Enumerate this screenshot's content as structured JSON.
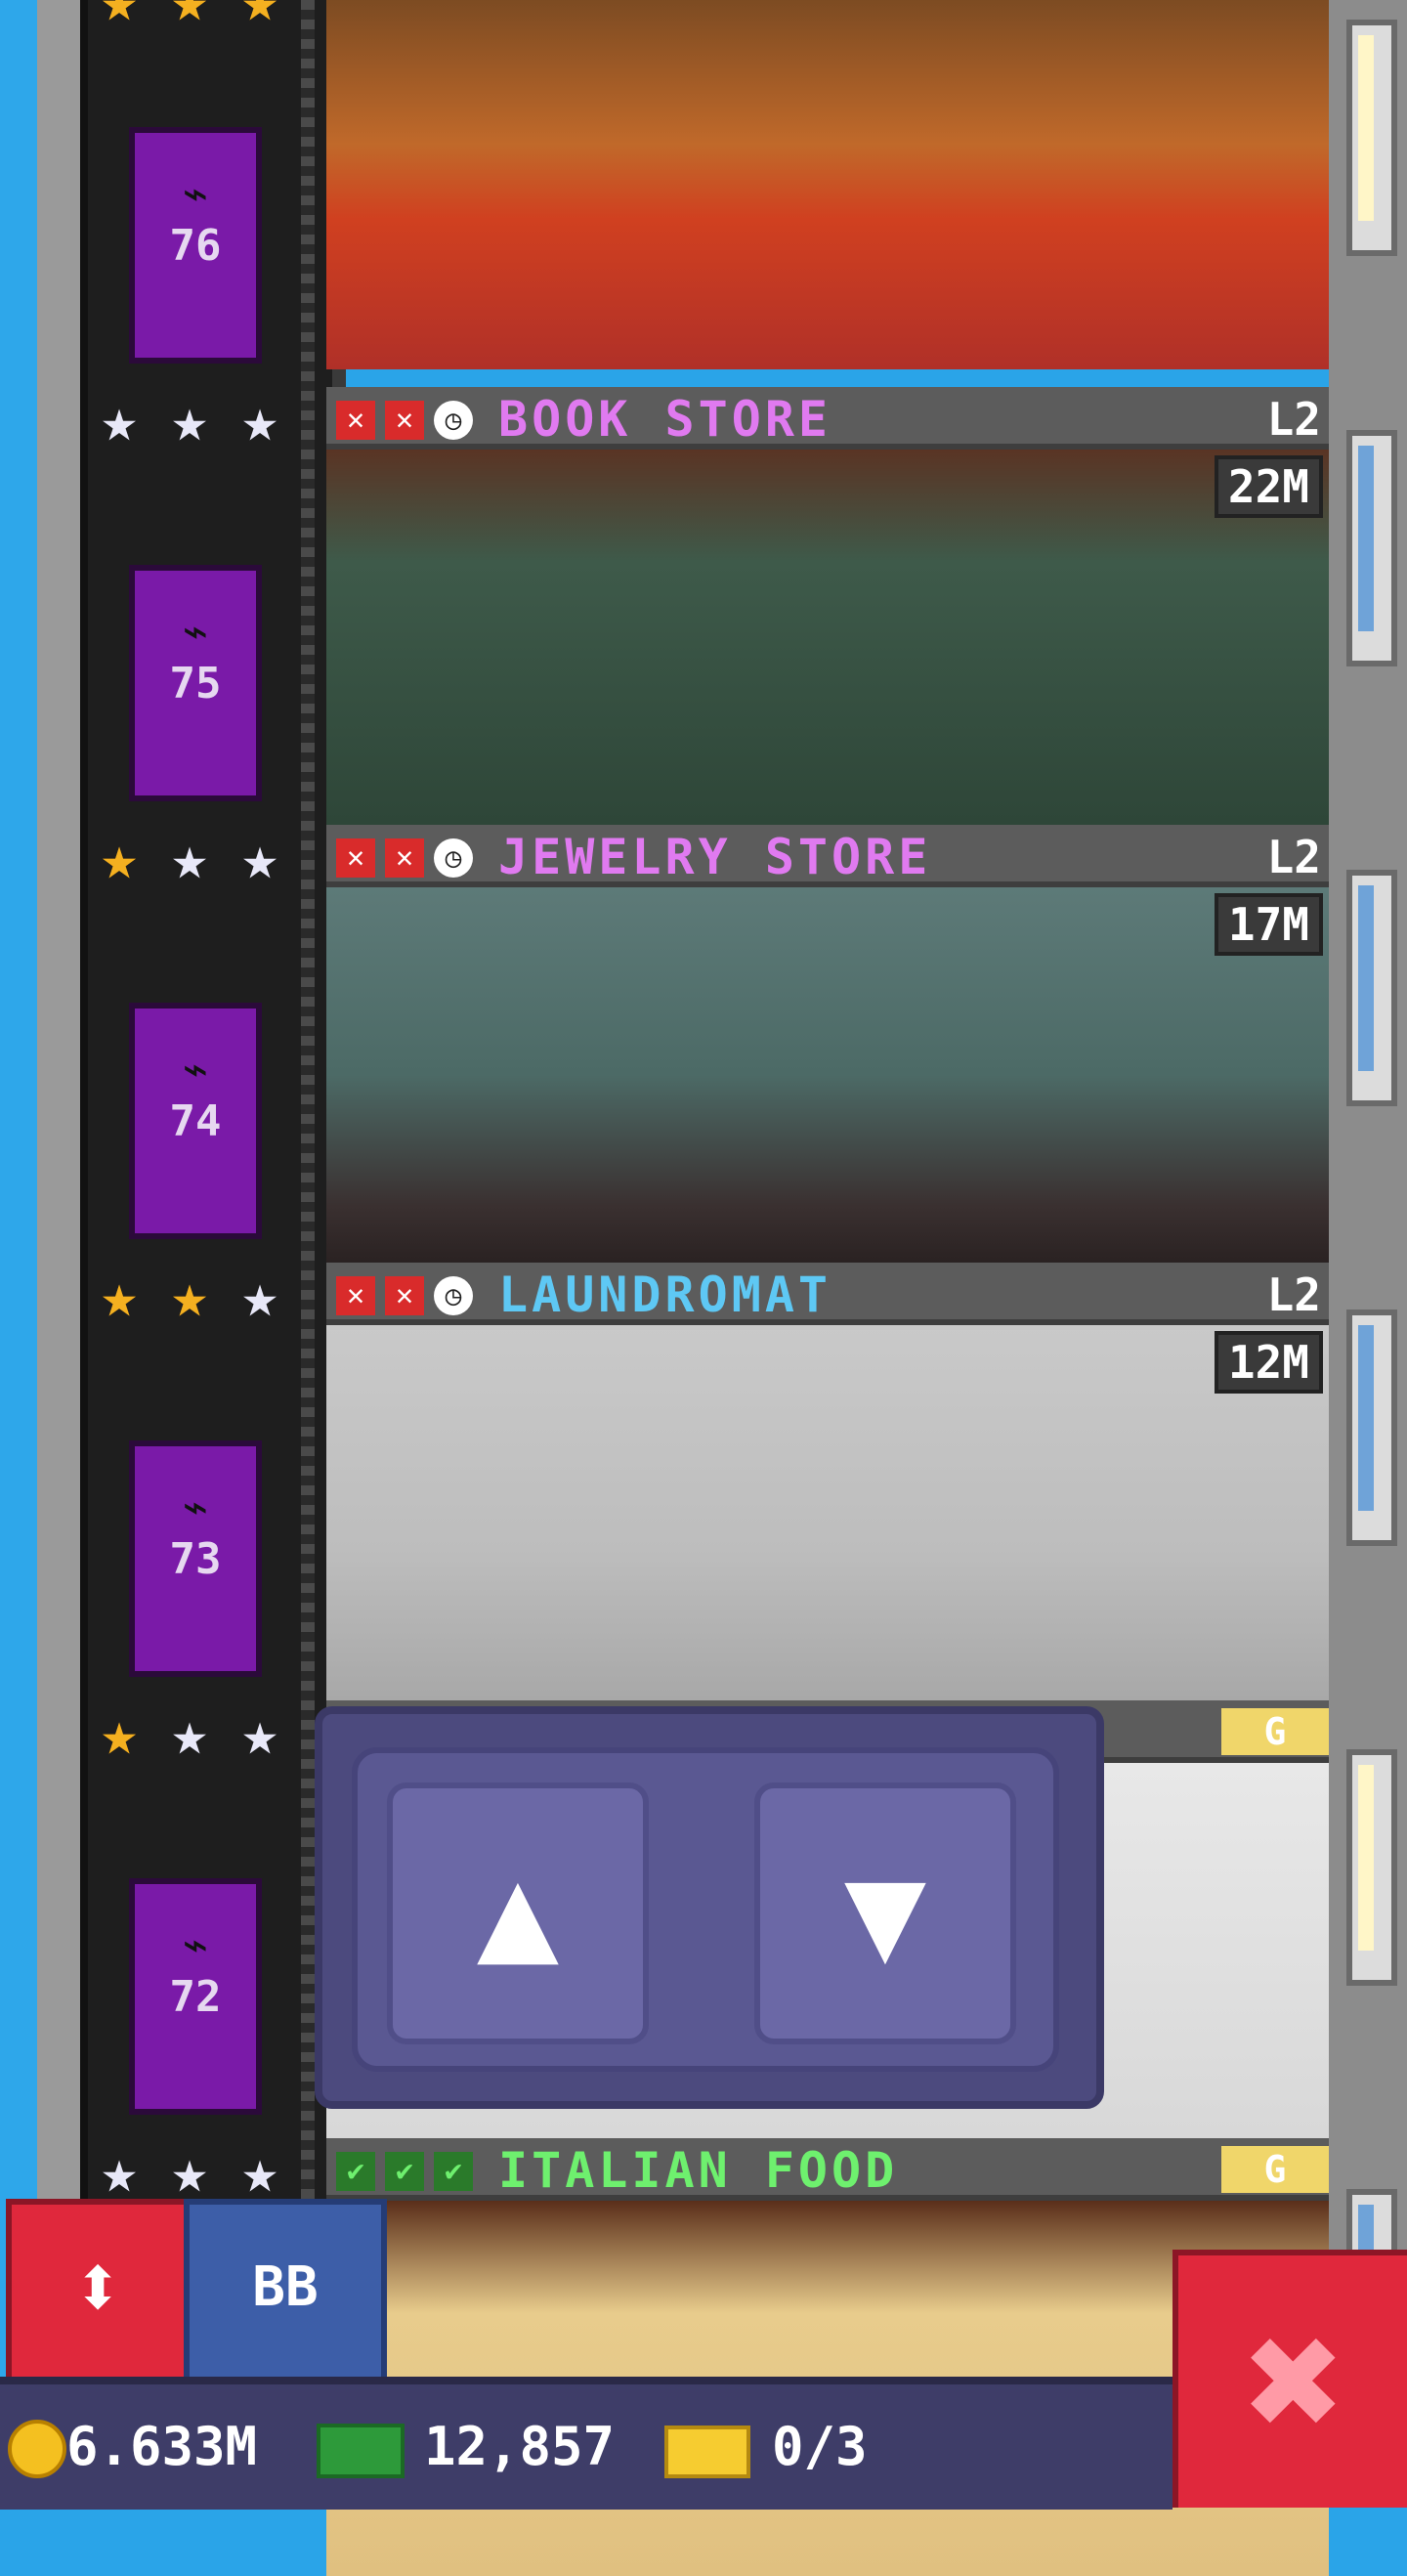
{
  "floors": [
    {
      "number": "76",
      "name": "",
      "level": "",
      "timer": "",
      "stars": [
        "gold",
        "gold",
        "gold"
      ],
      "statuses": [],
      "name_color": "#ffffff"
    },
    {
      "number": "75",
      "name": "BOOK STORE",
      "level": "L2",
      "timer": "22M",
      "stars": [
        "silver",
        "silver",
        "silver"
      ],
      "statuses": [
        "x",
        "x",
        "clock"
      ],
      "name_color": "#e07af0"
    },
    {
      "number": "74",
      "name": "JEWELRY STORE",
      "level": "L2",
      "timer": "17M",
      "stars": [
        "gold",
        "silver",
        "silver"
      ],
      "statuses": [
        "x",
        "x",
        "clock"
      ],
      "name_color": "#e07af0"
    },
    {
      "number": "73",
      "name": "LAUNDROMAT",
      "level": "L2",
      "timer": "12M",
      "stars": [
        "gold",
        "gold",
        "silver"
      ],
      "statuses": [
        "x",
        "x",
        "clock"
      ],
      "name_color": "#5ec8f4"
    },
    {
      "number": "72",
      "name": "",
      "level": "",
      "timer": "",
      "stars": [
        "gold",
        "silver",
        "silver"
      ],
      "statuses": [],
      "name_color": "#ffffff",
      "badge": "G"
    },
    {
      "number": "",
      "name": "ITALIAN FOOD",
      "level": "",
      "timer": "",
      "stars": [
        "silver",
        "silver",
        "silver"
      ],
      "statuses": [
        "check",
        "check",
        "check"
      ],
      "name_color": "#6ef06e",
      "badge": "G"
    }
  ],
  "controls": {
    "up_symbol": "▲",
    "down_symbol": "▼",
    "elevator_toggle_symbol": "⬍",
    "bb_label": "BB",
    "close_symbol": "✖"
  },
  "currency": {
    "coins": "6.633M",
    "bux": "12,857",
    "tickets": "0/3"
  }
}
